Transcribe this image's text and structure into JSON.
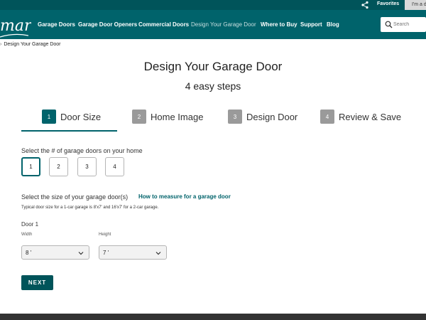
{
  "utility": {
    "favorites_label": "Favorites",
    "dealer_label": "I'm a d"
  },
  "header": {
    "logo_text": "marr",
    "nav": [
      {
        "label": "Garage Doors"
      },
      {
        "label": "Garage Door Openers"
      },
      {
        "label": "Commercial Doors"
      },
      {
        "label": "Design Your Garage Door"
      },
      {
        "label": "Where to Buy"
      },
      {
        "label": "Support"
      },
      {
        "label": "Blog"
      }
    ],
    "search_placeholder": "Search"
  },
  "breadcrumb": {
    "current": "Design Your Garage Door"
  },
  "main": {
    "title": "Design Your Garage Door",
    "subtitle": "4 easy steps",
    "steps": [
      {
        "num": "1",
        "label": "Door Size",
        "active": true
      },
      {
        "num": "2",
        "label": "Home Image",
        "active": false
      },
      {
        "num": "3",
        "label": "Design Door",
        "active": false
      },
      {
        "num": "4",
        "label": "Review & Save",
        "active": false
      }
    ],
    "count_label": "Select the # of garage doors on your home",
    "count_options": [
      "1",
      "2",
      "3",
      "4"
    ],
    "count_selected": "1",
    "size_label": "Select the size of your garage door(s)",
    "measure_link": "How to measure for a garage door",
    "hint": "Typical door size for a 1-car garage is 8'x7' and 16'x7' for a 2-car garage.",
    "door_label": "Door 1",
    "width_label": "Width",
    "width_value": "8 '",
    "height_label": "Height",
    "height_value": "7 '",
    "next_label": "NEXT"
  },
  "colors": {
    "brand": "#00636b",
    "brand_dark": "#00545a",
    "step_inactive": "#9a9a9a"
  }
}
